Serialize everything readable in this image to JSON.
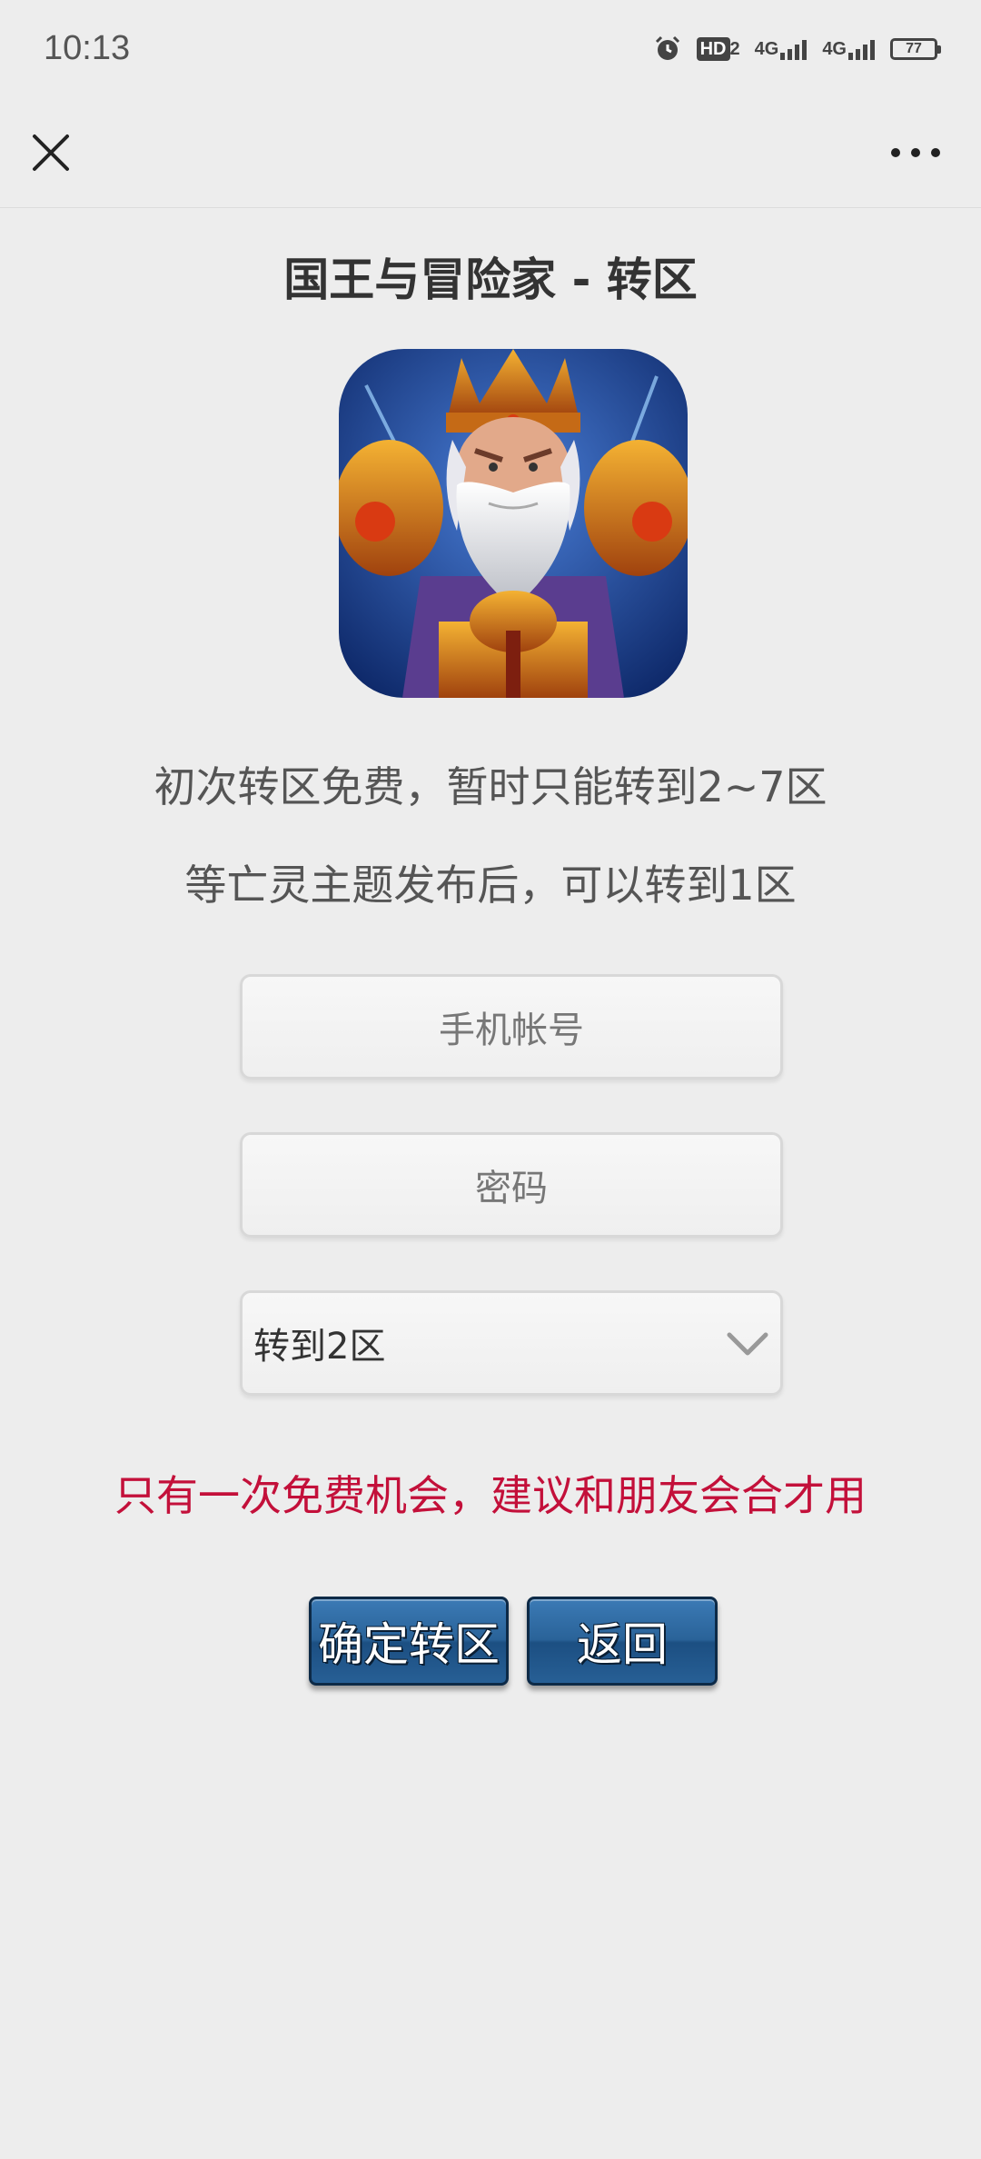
{
  "status_bar": {
    "time": "10:13",
    "hd_label": "HD",
    "hd_sim": "2",
    "network_1": "4G",
    "network_2": "4G",
    "battery": "77"
  },
  "nav": {
    "close_icon": "close-icon",
    "more_icon": "more-icon"
  },
  "page": {
    "title": "国王与冒险家 - 转区",
    "logo_icon": "game-logo-king-portrait",
    "notice_1": "初次转区免费，暂时只能转到2~7区",
    "notice_2": "等亡灵主题发布后，可以转到1区"
  },
  "form": {
    "phone_placeholder": "手机帐号",
    "password_placeholder": "密码",
    "zone_selected": "转到2区"
  },
  "warning": "只有一次免费机会，建议和朋友会合才用",
  "buttons": {
    "confirm": "确定转区",
    "back": "返回"
  },
  "colors": {
    "background": "#ededed",
    "warning": "#c3103a",
    "button": "#2a6399"
  }
}
